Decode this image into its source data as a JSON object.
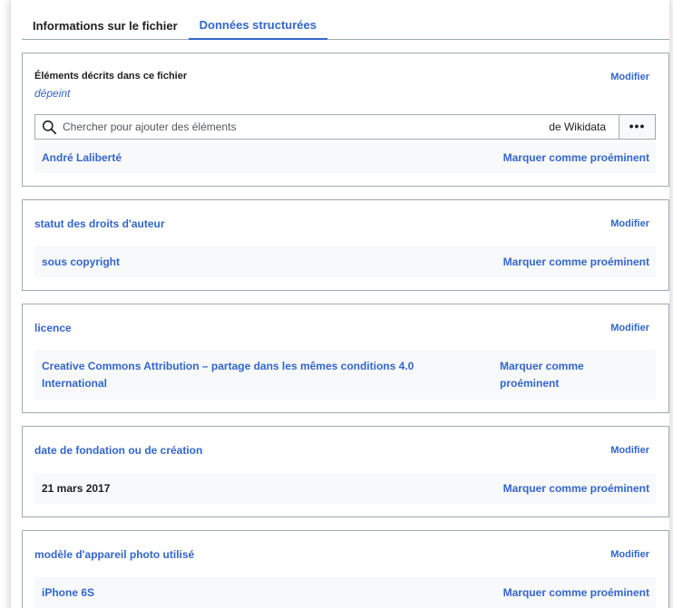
{
  "tabs": [
    {
      "label": "Informations sur le fichier",
      "active": false
    },
    {
      "label": "Données structurées",
      "active": true
    }
  ],
  "colors": {
    "accent": "#3366cc",
    "text": "#202122",
    "row_bg": "#f8f9fa",
    "border": "#a2a9b1"
  },
  "depicts": {
    "title": "Éléments décrits dans ce fichier",
    "subtitle": "dépeint",
    "modify_label": "Modifier",
    "search_placeholder": "Chercher pour ajouter des éléments",
    "search_source": "de Wikidata",
    "more_label": "•••",
    "value": "André Laliberté",
    "mark_label": "Marquer comme proéminent"
  },
  "copyright": {
    "title": "statut des droits d'auteur",
    "modify_label": "Modifier",
    "value": "sous copyright",
    "mark_label": "Marquer comme proéminent"
  },
  "license": {
    "title": "licence",
    "modify_label": "Modifier",
    "value_line1": "Creative Commons Attribution – partage dans les mêmes conditions 4.0",
    "value_line2": "International",
    "mark_line1": "Marquer comme",
    "mark_line2": "proéminent"
  },
  "inception": {
    "title": "date de fondation ou de création",
    "modify_label": "Modifier",
    "value": "21 mars 2017",
    "mark_label": "Marquer comme proéminent"
  },
  "camera": {
    "title": "modèle d'appareil photo utilisé",
    "modify_label": "Modifier",
    "value": "iPhone 6S",
    "mark_label": "Marquer comme proéminent"
  },
  "icons": {
    "search": "search-icon",
    "more": "more-options-icon"
  }
}
